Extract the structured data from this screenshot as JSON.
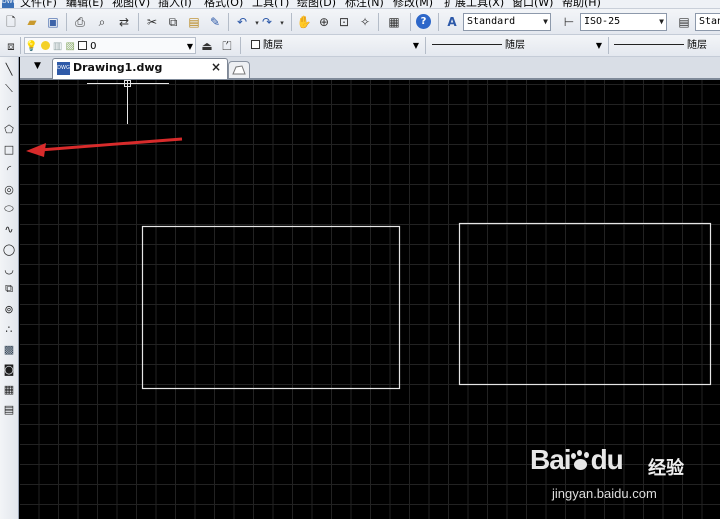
{
  "menubar": {
    "app_icon": "cad-app-icon",
    "items": [
      "文件(F)",
      "编辑(E)",
      "视图(V)",
      "插入(I)",
      "格式(O)",
      "工具(T)",
      "绘图(D)",
      "标注(N)",
      "修改(M)",
      "扩展工具(X)",
      "窗口(W)",
      "帮助(H)"
    ]
  },
  "toolbar": {
    "text_style": "Standard",
    "dim_style": "ISO-25",
    "table_style_partial": "Stan"
  },
  "layer_bar": {
    "layer_name": "0",
    "color": "随层",
    "linetype": "随层",
    "lineweight": "随层"
  },
  "tabs": [
    {
      "label": "Drawing1.dwg",
      "close": "×"
    }
  ],
  "left_tools": [
    "line-icon",
    "construction-line-icon",
    "polyline-icon",
    "polygon-icon",
    "rectangle-icon",
    "arc-icon",
    "circle-icon",
    "ellipse-icon",
    "spline-icon",
    "revision-cloud-icon",
    "ellipse-arc-icon",
    "insert-block-icon",
    "make-block-icon",
    "point-icon",
    "hatch-icon",
    "region-icon",
    "table-icon",
    "mtext-icon"
  ],
  "canvas": {
    "background": "#000000",
    "grid_color": "#222222",
    "shape_color": "#e6e6e6",
    "arrow_color": "#d82b2b"
  },
  "watermark": {
    "logo": "Bai",
    "logo_suffix": "du",
    "cn": "经验",
    "url": "jingyan.baidu.com"
  }
}
